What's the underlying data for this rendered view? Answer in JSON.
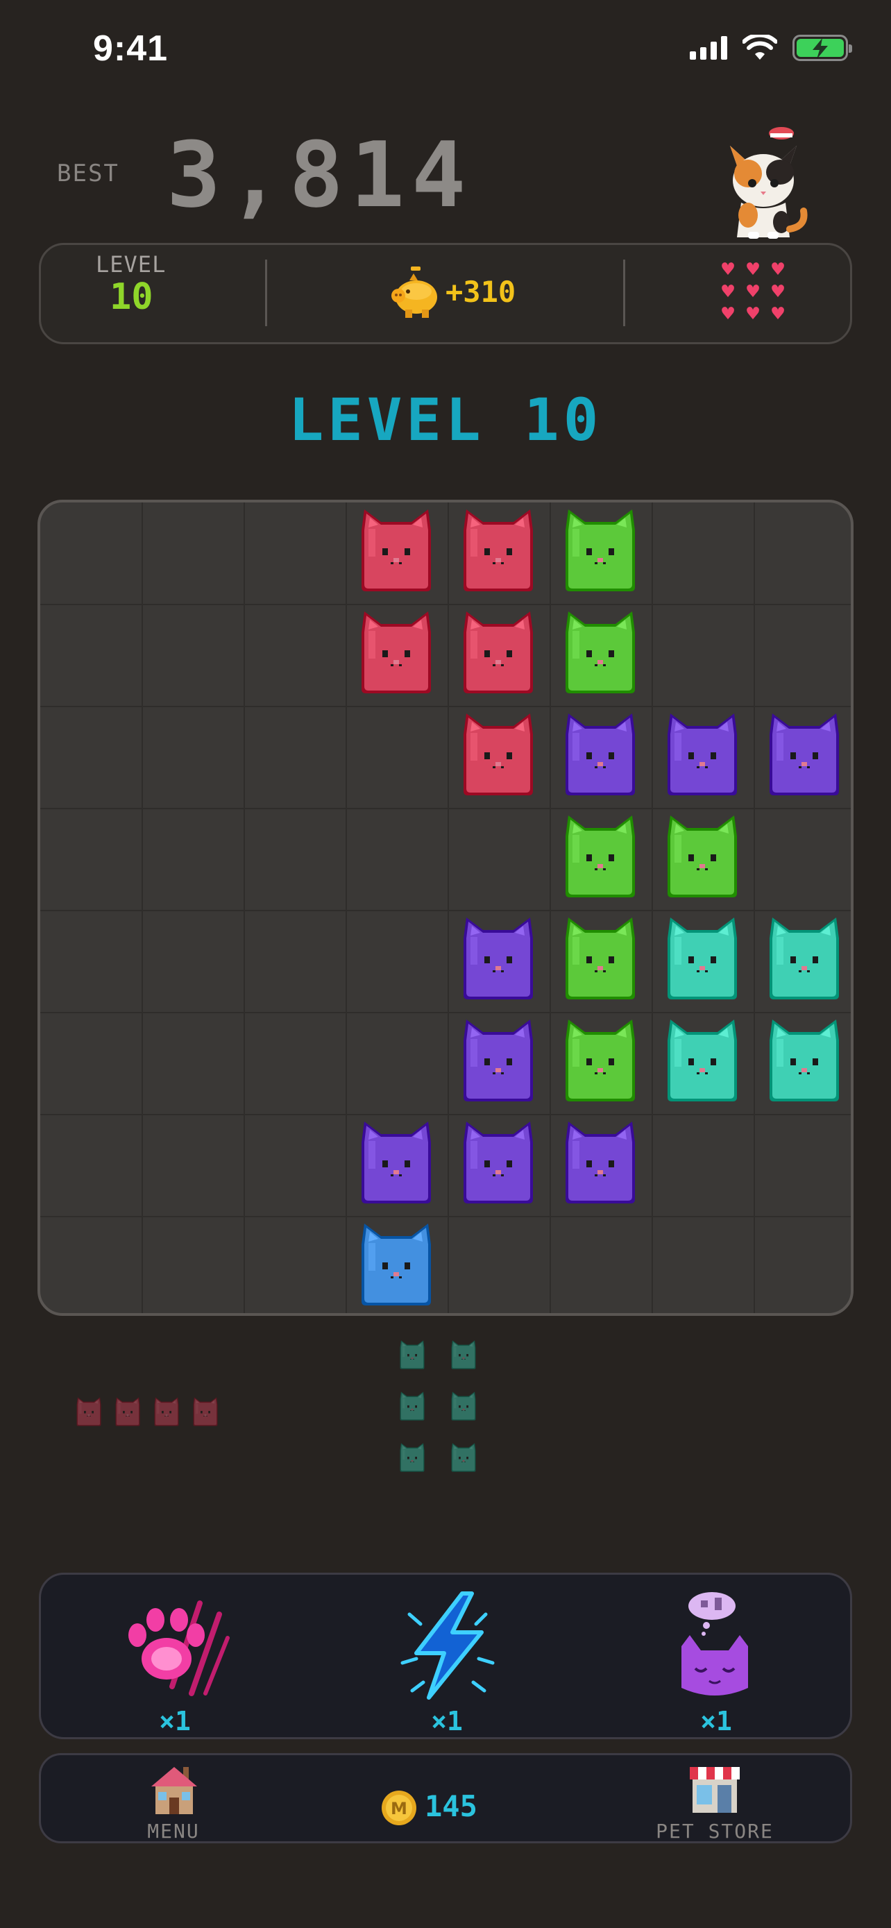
{
  "status_bar": {
    "time": "9:41"
  },
  "score": {
    "best_label": "BEST",
    "best_value": "3,814"
  },
  "stats": {
    "level_label": "LEVEL",
    "level_value": "10",
    "bonus": "+310",
    "hearts": 9
  },
  "level_title": "LEVEL 10",
  "board": {
    "rows": 8,
    "cols": 8,
    "cells": [
      [
        null,
        null,
        null,
        "red",
        "red",
        "green",
        null,
        null
      ],
      [
        null,
        null,
        null,
        "red",
        "red",
        "green",
        null,
        null
      ],
      [
        null,
        null,
        null,
        null,
        "red",
        "purple",
        "purple",
        "purple"
      ],
      [
        null,
        null,
        null,
        null,
        null,
        "green",
        "green",
        null
      ],
      [
        null,
        null,
        null,
        null,
        "purple",
        "green",
        "teal",
        "teal"
      ],
      [
        null,
        null,
        null,
        null,
        "purple",
        "green",
        "teal",
        "teal"
      ],
      [
        null,
        null,
        null,
        "purple",
        "purple",
        "purple",
        null,
        null
      ],
      [
        null,
        null,
        null,
        "blue",
        null,
        null,
        null,
        null
      ]
    ]
  },
  "queue": [
    {
      "color": "red",
      "shape": "1x4"
    },
    {
      "color": "teal",
      "shape": "3x2"
    }
  ],
  "colors": {
    "red": "#d8455f",
    "green": "#5cc93a",
    "purple": "#7547d4",
    "teal": "#3fd0b4",
    "blue": "#4390e0",
    "accent_cyan": "#2bc3de",
    "level_green": "#8fd62a",
    "gold": "#f2c21a"
  },
  "powerups": [
    {
      "icon": "paw-claw-icon",
      "count": "×1"
    },
    {
      "icon": "lightning-bolt-icon",
      "count": "×1"
    },
    {
      "icon": "sleepy-cat-icon",
      "count": "×1"
    }
  ],
  "nav": {
    "menu_label": "MENU",
    "coins": "145",
    "store_label": "PET STORE"
  }
}
